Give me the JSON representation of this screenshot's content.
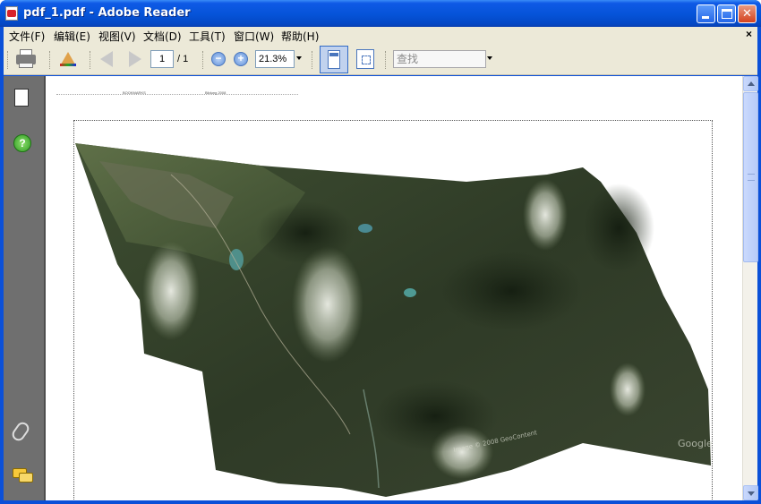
{
  "window": {
    "title": "pdf_1.pdf - Adobe Reader",
    "controls": {
      "minimize": "_",
      "maximize": "□",
      "close": "✕"
    }
  },
  "menu": {
    "items": [
      "文件(F)",
      "编辑(E)",
      "视图(V)",
      "文档(D)",
      "工具(T)",
      "窗口(W)",
      "帮助(H)"
    ],
    "close_doc": "×"
  },
  "toolbar": {
    "current_page": "1",
    "page_total": "/ 1",
    "zoom_out": "−",
    "zoom_in": "+",
    "zoom_value": "21.3%",
    "search_placeholder": "查找"
  },
  "nav": {
    "help": "?"
  },
  "document": {
    "header_left": "BOOKMARKS",
    "header_right": "Bildung 2008",
    "watermark_left": "Image © 2008 GeoContent",
    "watermark_right": "Google"
  },
  "colors": {
    "titlebar": "#0553d8",
    "chrome": "#ece9d8",
    "nav_panel": "#6f6f6f",
    "terrain_dark": "#2f3a26",
    "terrain_light": "#6f7d55",
    "snow": "#dfe3d6"
  },
  "icons": {
    "print": "printer-icon",
    "color": "color-management-icon",
    "prev": "arrow-left-icon",
    "next": "arrow-right-icon",
    "pages": "pages-icon",
    "help": "help-icon",
    "attachments": "paperclip-icon",
    "comments": "comments-icon"
  }
}
